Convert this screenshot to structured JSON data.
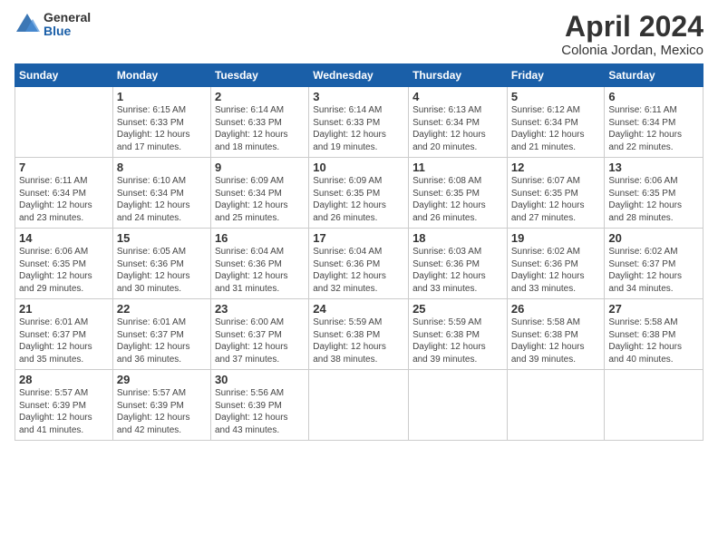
{
  "header": {
    "logo_general": "General",
    "logo_blue": "Blue",
    "month_title": "April 2024",
    "subtitle": "Colonia Jordan, Mexico"
  },
  "days_of_week": [
    "Sunday",
    "Monday",
    "Tuesday",
    "Wednesday",
    "Thursday",
    "Friday",
    "Saturday"
  ],
  "weeks": [
    [
      {
        "day": "",
        "info": ""
      },
      {
        "day": "1",
        "info": "Sunrise: 6:15 AM\nSunset: 6:33 PM\nDaylight: 12 hours\nand 17 minutes."
      },
      {
        "day": "2",
        "info": "Sunrise: 6:14 AM\nSunset: 6:33 PM\nDaylight: 12 hours\nand 18 minutes."
      },
      {
        "day": "3",
        "info": "Sunrise: 6:14 AM\nSunset: 6:33 PM\nDaylight: 12 hours\nand 19 minutes."
      },
      {
        "day": "4",
        "info": "Sunrise: 6:13 AM\nSunset: 6:34 PM\nDaylight: 12 hours\nand 20 minutes."
      },
      {
        "day": "5",
        "info": "Sunrise: 6:12 AM\nSunset: 6:34 PM\nDaylight: 12 hours\nand 21 minutes."
      },
      {
        "day": "6",
        "info": "Sunrise: 6:11 AM\nSunset: 6:34 PM\nDaylight: 12 hours\nand 22 minutes."
      }
    ],
    [
      {
        "day": "7",
        "info": "Sunrise: 6:11 AM\nSunset: 6:34 PM\nDaylight: 12 hours\nand 23 minutes."
      },
      {
        "day": "8",
        "info": "Sunrise: 6:10 AM\nSunset: 6:34 PM\nDaylight: 12 hours\nand 24 minutes."
      },
      {
        "day": "9",
        "info": "Sunrise: 6:09 AM\nSunset: 6:34 PM\nDaylight: 12 hours\nand 25 minutes."
      },
      {
        "day": "10",
        "info": "Sunrise: 6:09 AM\nSunset: 6:35 PM\nDaylight: 12 hours\nand 26 minutes."
      },
      {
        "day": "11",
        "info": "Sunrise: 6:08 AM\nSunset: 6:35 PM\nDaylight: 12 hours\nand 26 minutes."
      },
      {
        "day": "12",
        "info": "Sunrise: 6:07 AM\nSunset: 6:35 PM\nDaylight: 12 hours\nand 27 minutes."
      },
      {
        "day": "13",
        "info": "Sunrise: 6:06 AM\nSunset: 6:35 PM\nDaylight: 12 hours\nand 28 minutes."
      }
    ],
    [
      {
        "day": "14",
        "info": "Sunrise: 6:06 AM\nSunset: 6:35 PM\nDaylight: 12 hours\nand 29 minutes."
      },
      {
        "day": "15",
        "info": "Sunrise: 6:05 AM\nSunset: 6:36 PM\nDaylight: 12 hours\nand 30 minutes."
      },
      {
        "day": "16",
        "info": "Sunrise: 6:04 AM\nSunset: 6:36 PM\nDaylight: 12 hours\nand 31 minutes."
      },
      {
        "day": "17",
        "info": "Sunrise: 6:04 AM\nSunset: 6:36 PM\nDaylight: 12 hours\nand 32 minutes."
      },
      {
        "day": "18",
        "info": "Sunrise: 6:03 AM\nSunset: 6:36 PM\nDaylight: 12 hours\nand 33 minutes."
      },
      {
        "day": "19",
        "info": "Sunrise: 6:02 AM\nSunset: 6:36 PM\nDaylight: 12 hours\nand 33 minutes."
      },
      {
        "day": "20",
        "info": "Sunrise: 6:02 AM\nSunset: 6:37 PM\nDaylight: 12 hours\nand 34 minutes."
      }
    ],
    [
      {
        "day": "21",
        "info": "Sunrise: 6:01 AM\nSunset: 6:37 PM\nDaylight: 12 hours\nand 35 minutes."
      },
      {
        "day": "22",
        "info": "Sunrise: 6:01 AM\nSunset: 6:37 PM\nDaylight: 12 hours\nand 36 minutes."
      },
      {
        "day": "23",
        "info": "Sunrise: 6:00 AM\nSunset: 6:37 PM\nDaylight: 12 hours\nand 37 minutes."
      },
      {
        "day": "24",
        "info": "Sunrise: 5:59 AM\nSunset: 6:38 PM\nDaylight: 12 hours\nand 38 minutes."
      },
      {
        "day": "25",
        "info": "Sunrise: 5:59 AM\nSunset: 6:38 PM\nDaylight: 12 hours\nand 39 minutes."
      },
      {
        "day": "26",
        "info": "Sunrise: 5:58 AM\nSunset: 6:38 PM\nDaylight: 12 hours\nand 39 minutes."
      },
      {
        "day": "27",
        "info": "Sunrise: 5:58 AM\nSunset: 6:38 PM\nDaylight: 12 hours\nand 40 minutes."
      }
    ],
    [
      {
        "day": "28",
        "info": "Sunrise: 5:57 AM\nSunset: 6:39 PM\nDaylight: 12 hours\nand 41 minutes."
      },
      {
        "day": "29",
        "info": "Sunrise: 5:57 AM\nSunset: 6:39 PM\nDaylight: 12 hours\nand 42 minutes."
      },
      {
        "day": "30",
        "info": "Sunrise: 5:56 AM\nSunset: 6:39 PM\nDaylight: 12 hours\nand 43 minutes."
      },
      {
        "day": "",
        "info": ""
      },
      {
        "day": "",
        "info": ""
      },
      {
        "day": "",
        "info": ""
      },
      {
        "day": "",
        "info": ""
      }
    ]
  ]
}
